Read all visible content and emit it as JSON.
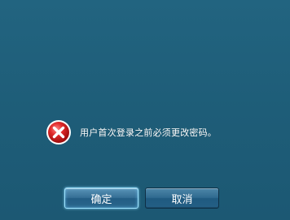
{
  "dialog": {
    "message": "用户首次登录之前必须更改密码。",
    "icon": "error-icon"
  },
  "buttons": {
    "ok_label": "确定",
    "cancel_label": "取消"
  },
  "colors": {
    "background": "#1f5f7a",
    "error_red": "#d42020",
    "button_blue": "#2f6a90",
    "focus_glow": "#9fe4ff"
  }
}
